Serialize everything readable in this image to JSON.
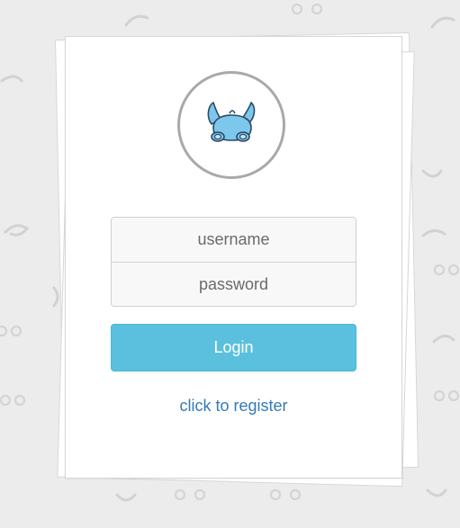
{
  "login_form": {
    "username_placeholder": "username",
    "password_placeholder": "password",
    "login_label": "Login",
    "register_label": "click to register"
  },
  "icons": {
    "avatar": "pet-mascot-icon",
    "background": "doodle-pattern"
  },
  "colors": {
    "page_background": "#ececec",
    "card_background": "#ffffff",
    "login_button": "#5bc0de",
    "register_link": "#337ab7",
    "mascot": "#7ec7ec",
    "avatar_ring": "#a9a9a9"
  }
}
